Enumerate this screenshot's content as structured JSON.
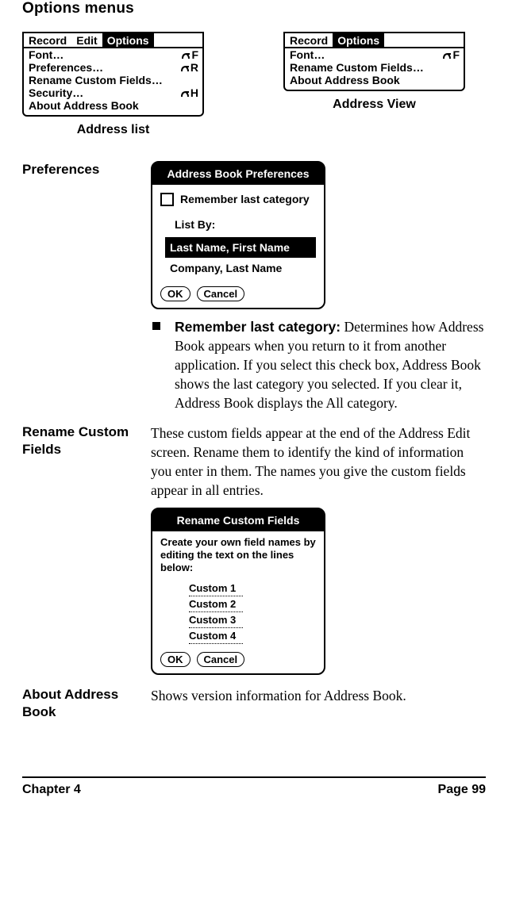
{
  "section_title": "Options menus",
  "address_list_menu": {
    "tabs": [
      "Record",
      "Edit",
      "Options"
    ],
    "active_tab_index": 2,
    "items": [
      {
        "label": "Font…",
        "shortcut": "F"
      },
      {
        "label": "Preferences…",
        "shortcut": "R"
      },
      {
        "label": "Rename Custom Fields…",
        "shortcut": ""
      },
      {
        "label": "Security…",
        "shortcut": "H"
      },
      {
        "label": "About Address Book",
        "shortcut": ""
      }
    ]
  },
  "address_view_menu": {
    "tabs": [
      "Record",
      "Options"
    ],
    "active_tab_index": 1,
    "items": [
      {
        "label": "Font…",
        "shortcut": "F"
      },
      {
        "label": "Rename Custom Fields…",
        "shortcut": ""
      },
      {
        "label": "About Address Book",
        "shortcut": ""
      }
    ]
  },
  "captions": {
    "address_list": "Address list",
    "address_view": "Address View"
  },
  "terms": {
    "preferences": "Preferences",
    "rename_custom": "Rename Custom Fields",
    "about": "About Address Book"
  },
  "prefs_dialog": {
    "title": "Address Book Preferences",
    "checkbox_label": "Remember last category",
    "listby_label": "List By:",
    "options": [
      "Last Name, First Name",
      "Company, Last Name"
    ],
    "selected_option_index": 0,
    "ok": "OK",
    "cancel": "Cancel"
  },
  "remember_bullet": {
    "lead": "Remember last category:",
    "body": " Determines how Address Book appears when you return to it from another application. If you select this check box, Address Book shows the last category you selected. If you clear it, Address Book displays the All category."
  },
  "rename_desc": "These custom fields appear at the end of the Address Edit screen. Rename them to identify the kind of information you enter in them. The names you give the custom fields appear in all entries.",
  "rename_dialog": {
    "title": "Rename Custom Fields",
    "instruction": "Create your own field names by editing the text on the lines below:",
    "fields": [
      "Custom 1",
      "Custom 2",
      "Custom 3",
      "Custom 4"
    ],
    "ok": "OK",
    "cancel": "Cancel"
  },
  "about_desc": "Shows version information for Address Book.",
  "footer": {
    "left": "Chapter 4",
    "right": "Page 99"
  }
}
